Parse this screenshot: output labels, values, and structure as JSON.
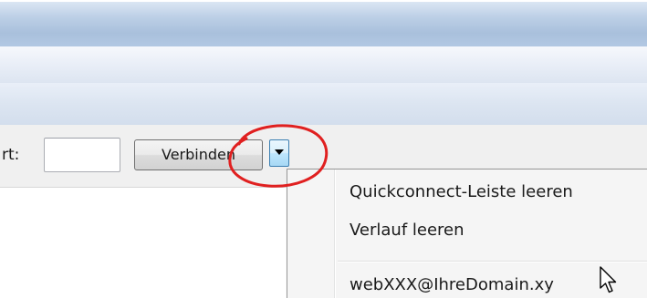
{
  "quickconnect": {
    "port_label": "rt:",
    "port_value": "",
    "connect_label": "Verbinden"
  },
  "dropdown_menu": {
    "items": [
      {
        "label": "Quickconnect-Leiste leeren"
      },
      {
        "label": "Verlauf leeren"
      }
    ],
    "history_entries": [
      {
        "label": "webXXX@IhreDomain.xy"
      }
    ]
  },
  "annotation": {
    "highlight_color": "#e02020"
  },
  "icons": {
    "dropdown": "chevron-down-icon",
    "cursor": "mouse-cursor-icon"
  }
}
